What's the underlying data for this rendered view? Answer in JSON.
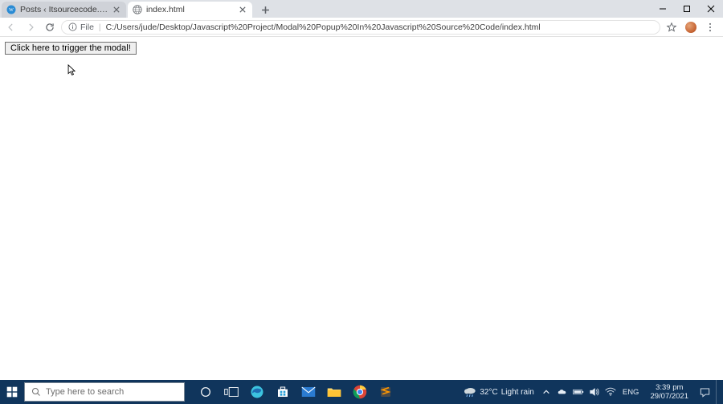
{
  "window": {
    "tabs": [
      {
        "title": "Posts ‹ Itsourcecode.com — Wo",
        "favicon": "wordpress"
      },
      {
        "title": "index.html",
        "favicon": "file"
      }
    ],
    "controls": {
      "min": "–",
      "max": "▢",
      "close": "✕"
    }
  },
  "toolbar": {
    "site_info_label": "File",
    "url": "C:/Users/jude/Desktop/Javascript%20Project/Modal%20Popup%20In%20Javascript%20Source%20Code/index.html"
  },
  "page": {
    "trigger_button_label": "Click here to trigger the modal!"
  },
  "taskbar": {
    "search_placeholder": "Type here to search",
    "weather_temp": "32°C",
    "weather_desc": "Light rain",
    "lang": "ENG",
    "time": "3:39 pm",
    "date": "29/07/2021"
  }
}
